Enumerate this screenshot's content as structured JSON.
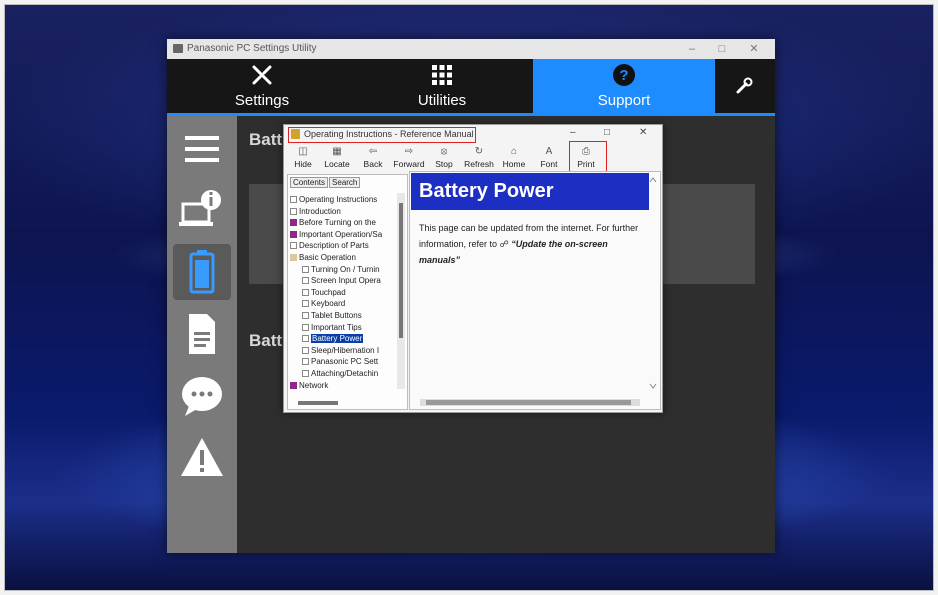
{
  "app": {
    "title": "Panasonic PC Settings Utility",
    "nav_tabs": [
      {
        "label": "Settings",
        "icon": "tools-icon"
      },
      {
        "label": "Utilities",
        "icon": "grid-icon"
      },
      {
        "label": "Support",
        "icon": "help-icon"
      }
    ],
    "wrench": "wrench-icon",
    "content_heading_1": "Batt",
    "content_heading_2": "Batt"
  },
  "help": {
    "title": "Operating Instructions - Reference Manual",
    "toolbar": [
      "Hide",
      "Locate",
      "Back",
      "Forward",
      "Stop",
      "Refresh",
      "Home",
      "Font",
      "Print"
    ],
    "tree_tabs": [
      "Contents",
      "Search"
    ],
    "tree_items": [
      "Operating Instructions",
      "Introduction",
      "Before Turning on the",
      "Important Operation/Sa",
      "Description of Parts",
      "Basic Operation",
      "Turning On / Turnin",
      "Screen Input Opera",
      "Touchpad",
      "Keyboard",
      "Tablet Buttons",
      "Important Tips",
      "Battery Power",
      "Sleep/Hibernation I",
      "Panasonic PC Sett",
      "Attaching/Detachin",
      "Network"
    ],
    "page_title": "Battery Power",
    "body_text": "This page can be updated from the internet. For further information, refer to",
    "body_link": "“Update the on-screen manuals”"
  },
  "colors": {
    "accent": "#1e8bff",
    "banner": "#1d2ec3",
    "highlight": "#e02020"
  }
}
